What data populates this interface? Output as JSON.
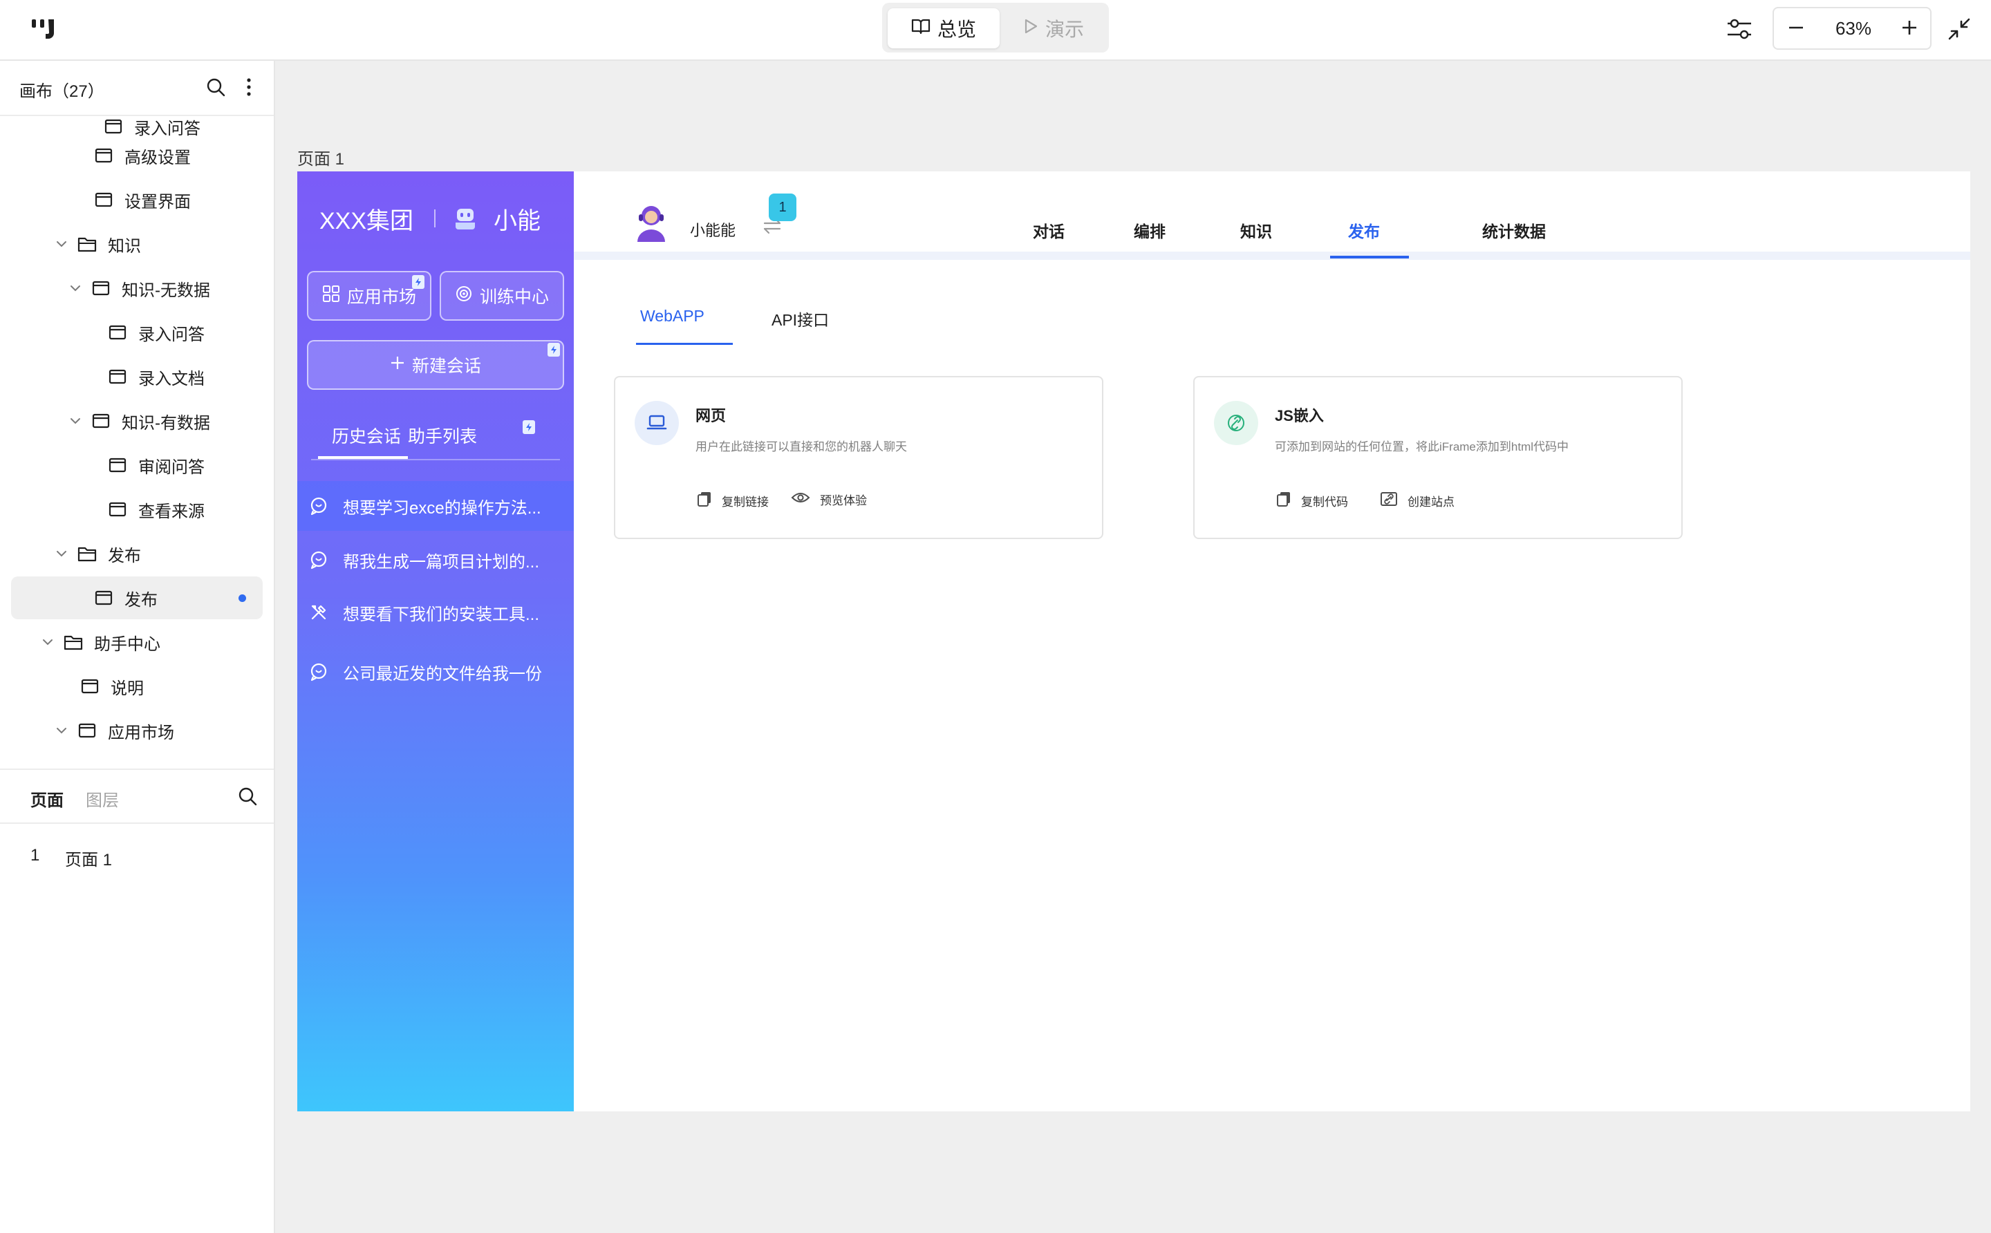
{
  "topbar": {
    "mode_overview": "总览",
    "mode_present": "演示",
    "zoom": "63%"
  },
  "sidebar": {
    "title": "画布（27）",
    "tree": [
      {
        "label": "录入问答",
        "type": "page",
        "level": 4
      },
      {
        "label": "高级设置",
        "type": "page",
        "level": 3
      },
      {
        "label": "设置界面",
        "type": "page",
        "level": 3
      },
      {
        "label": "知识",
        "type": "folder",
        "level": 2,
        "expanded": true
      },
      {
        "label": "知识-无数据",
        "type": "page",
        "level": 3,
        "expanded": true
      },
      {
        "label": "录入问答",
        "type": "page",
        "level": 4
      },
      {
        "label": "录入文档",
        "type": "page",
        "level": 4
      },
      {
        "label": "知识-有数据",
        "type": "page",
        "level": 3,
        "expanded": true
      },
      {
        "label": "审阅问答",
        "type": "page",
        "level": 4
      },
      {
        "label": "查看来源",
        "type": "page",
        "level": 4
      },
      {
        "label": "发布",
        "type": "folder",
        "level": 2,
        "expanded": true
      },
      {
        "label": "发布",
        "type": "page",
        "level": 3,
        "selected": true
      },
      {
        "label": "助手中心",
        "type": "folder",
        "level": 1,
        "expanded": true
      },
      {
        "label": "说明",
        "type": "page",
        "level": 2
      },
      {
        "label": "应用市场",
        "type": "page",
        "level": 2,
        "expanded": true
      }
    ],
    "tab_pages": "页面",
    "tab_layers": "图层",
    "pages": [
      {
        "num": "1",
        "name": "页面 1"
      }
    ]
  },
  "frame": {
    "label": "页面 1",
    "left_panel": {
      "brand": "XXX集团",
      "brand_product": "小能",
      "btn_market": "应用市场",
      "btn_train": "训练中心",
      "btn_new": "新建会话",
      "tab_history": "历史会话",
      "tab_helpers": "助手列表",
      "conversations": [
        {
          "text": "想要学习exce的操作方法...",
          "icon": "chat-icon",
          "active": true
        },
        {
          "text": "帮我生成一篇项目计划的...",
          "icon": "chat-icon"
        },
        {
          "text": "想要看下我们的安装工具...",
          "icon": "tools-icon"
        },
        {
          "text": "公司最近发的文件给我一份",
          "icon": "chat-icon"
        }
      ]
    },
    "header": {
      "app_name": "小能能",
      "badge": "1",
      "tabs": [
        "对话",
        "编排",
        "知识",
        "发布",
        "统计数据"
      ],
      "active_tab": "发布"
    },
    "sub_tabs": [
      "WebAPP",
      "API接口"
    ],
    "cards": [
      {
        "title": "网页",
        "desc": "用户在此链接可以直接和您的机器人聊天",
        "action1": "复制链接",
        "action2": "预览体验",
        "icon": "laptop-icon"
      },
      {
        "title": "JS嵌入",
        "desc": "可添加到网站的任何位置，将此iFrame添加到html代码中",
        "action1": "复制代码",
        "action2": "创建站点",
        "icon": "link-icon"
      }
    ]
  }
}
